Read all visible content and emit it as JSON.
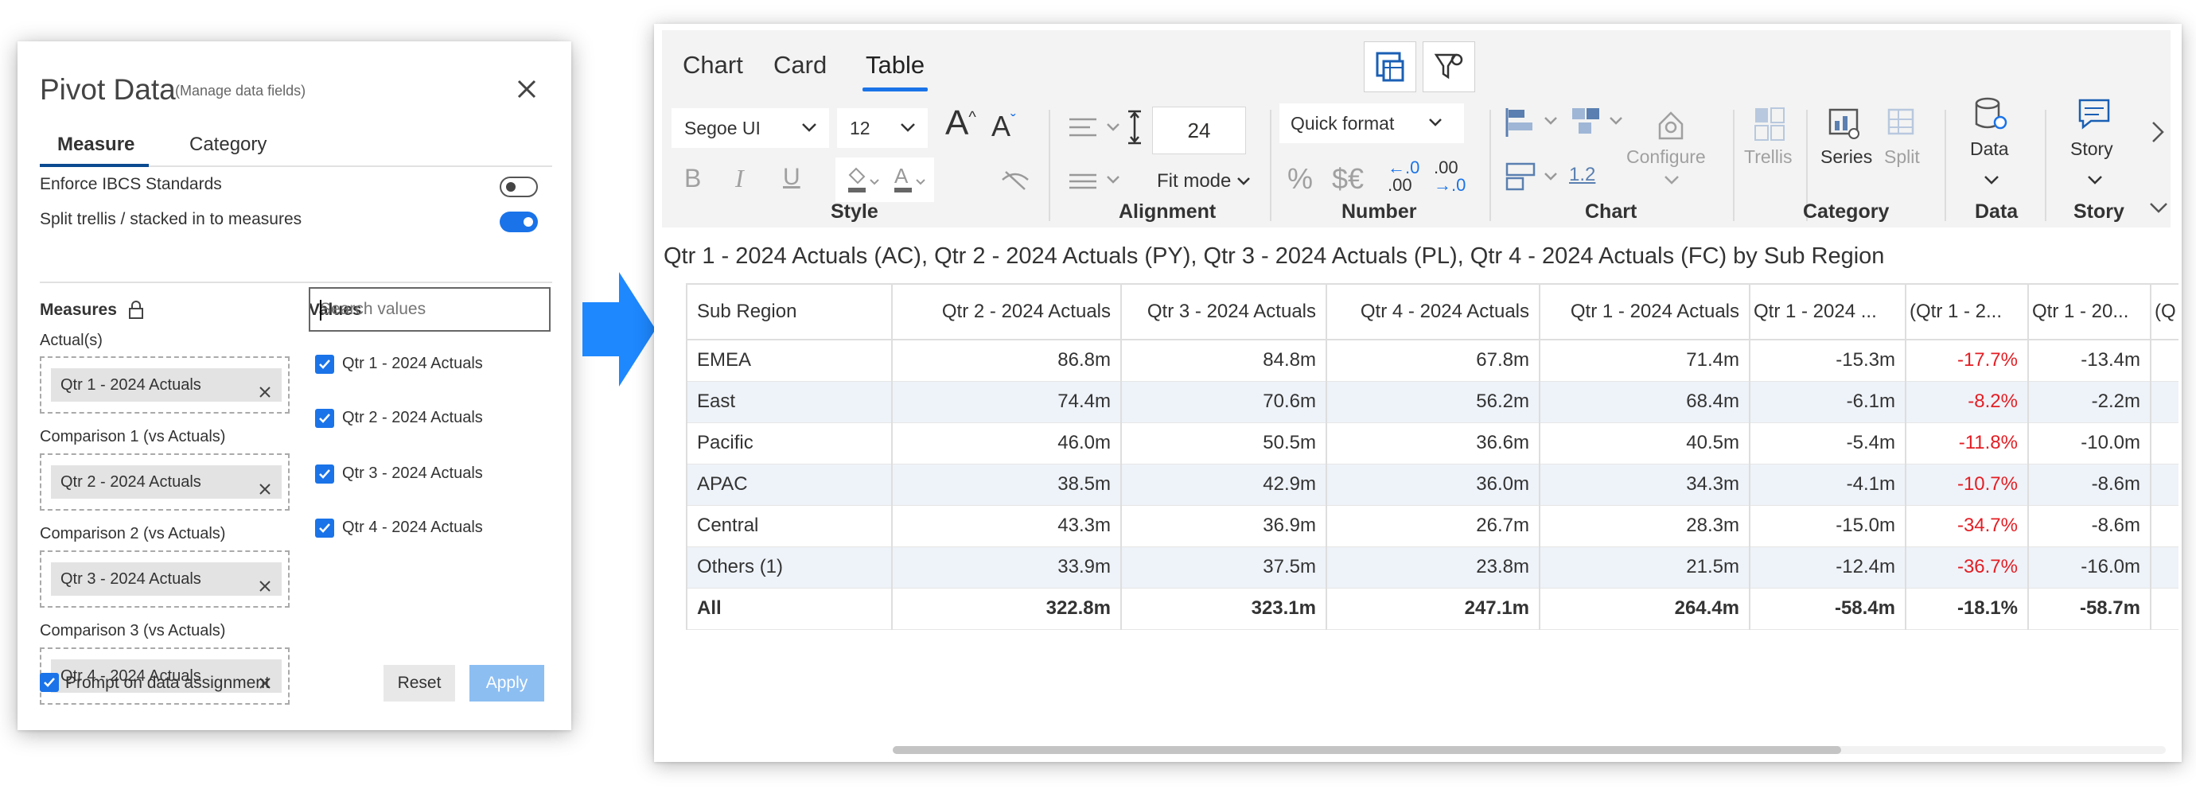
{
  "pivot": {
    "title": "Pivot Data",
    "subtitle": "(Manage data fields)",
    "tabs": [
      "Measure",
      "Category"
    ],
    "options": [
      {
        "label": "Enforce IBCS Standards",
        "on": false
      },
      {
        "label": "Split trellis / stacked in to measures",
        "on": true
      }
    ],
    "measures_heading": "Measures",
    "values_heading": "Values",
    "slots": [
      {
        "label": "Actual(s)",
        "chip": "Qtr 1 - 2024 Actuals"
      },
      {
        "label": "Comparison 1 (vs Actuals)",
        "chip": "Qtr 2 - 2024 Actuals"
      },
      {
        "label": "Comparison 2 (vs Actuals)",
        "chip": "Qtr 3 - 2024 Actuals"
      },
      {
        "label": "Comparison 3 (vs Actuals)",
        "chip": "Qtr 4 - 2024 Actuals"
      }
    ],
    "search_placeholder": "Search values",
    "values": [
      {
        "label": "Qtr 1 - 2024 Actuals",
        "checked": true
      },
      {
        "label": "Qtr 2 - 2024 Actuals",
        "checked": true
      },
      {
        "label": "Qtr 3 - 2024 Actuals",
        "checked": true
      },
      {
        "label": "Qtr 4 - 2024 Actuals",
        "checked": true
      }
    ],
    "prompt_label": "Prompt on data assignment",
    "prompt_checked": true,
    "reset_label": "Reset",
    "apply_label": "Apply"
  },
  "ribbon": {
    "tabs": [
      "Chart",
      "Card",
      "Table"
    ],
    "active_tab": "Table",
    "font_family": "Segoe UI",
    "font_size": "12",
    "font_grow": "A",
    "font_shrink": "A",
    "bold": "B",
    "italic": "I",
    "underline": "U",
    "row_height": "24",
    "fit_mode": "Fit mode",
    "quick_format": "Quick format",
    "percent": "%",
    "currency": "$€",
    "decimal_dec": ".0",
    "decimal_inc": ".00",
    "decimal_dec_sub": ".00",
    "decimal_inc_sub": "→.0",
    "chart_value": "1.2",
    "configure": "Configure",
    "trellis": "Trellis",
    "series": "Series",
    "split": "Split",
    "data": "Data",
    "story": "Story",
    "groups": [
      "Style",
      "Alignment",
      "Number",
      "Chart",
      "Category",
      "Data",
      "Story"
    ]
  },
  "caption": "Qtr 1 - 2024 Actuals (AC), Qtr 2 - 2024 Actuals (PY), Qtr 3 - 2024 Actuals (PL), Qtr 4 - 2024 Actuals (FC) by Sub Region",
  "table": {
    "columns": [
      "Sub Region",
      "Qtr 2 - 2024 Actuals",
      "Qtr 3 - 2024 Actuals",
      "Qtr 4 - 2024 Actuals",
      "Qtr 1 - 2024 Actuals",
      "Qtr 1 - 2024 ...",
      "(Qtr 1 - 2...",
      "Qtr 1 - 20...",
      "(Q"
    ],
    "rows": [
      {
        "region": "EMEA",
        "cells": [
          "86.8m",
          "84.8m",
          "67.8m",
          "71.4m",
          "-15.3m",
          "-17.7%",
          "-13.4m"
        ]
      },
      {
        "region": "East",
        "cells": [
          "74.4m",
          "70.6m",
          "56.2m",
          "68.4m",
          "-6.1m",
          "-8.2%",
          "-2.2m"
        ]
      },
      {
        "region": "Pacific",
        "cells": [
          "46.0m",
          "50.5m",
          "36.6m",
          "40.5m",
          "-5.4m",
          "-11.8%",
          "-10.0m"
        ]
      },
      {
        "region": "APAC",
        "cells": [
          "38.5m",
          "42.9m",
          "36.0m",
          "34.3m",
          "-4.1m",
          "-10.7%",
          "-8.6m"
        ]
      },
      {
        "region": "Central",
        "cells": [
          "43.3m",
          "36.9m",
          "26.7m",
          "28.3m",
          "-15.0m",
          "-34.7%",
          "-8.6m"
        ]
      },
      {
        "region": "Others (1)",
        "cells": [
          "33.9m",
          "37.5m",
          "23.8m",
          "21.5m",
          "-12.4m",
          "-36.7%",
          "-16.0m"
        ]
      },
      {
        "region": "All",
        "cells": [
          "322.8m",
          "323.1m",
          "247.1m",
          "264.4m",
          "-58.4m",
          "-18.1%",
          "-58.7m"
        ]
      }
    ]
  },
  "colors": {
    "accent": "#1a73e8",
    "negative": "#e31e24",
    "arrow": "#1e88ff",
    "apply_disabled": "#8cbef2"
  }
}
